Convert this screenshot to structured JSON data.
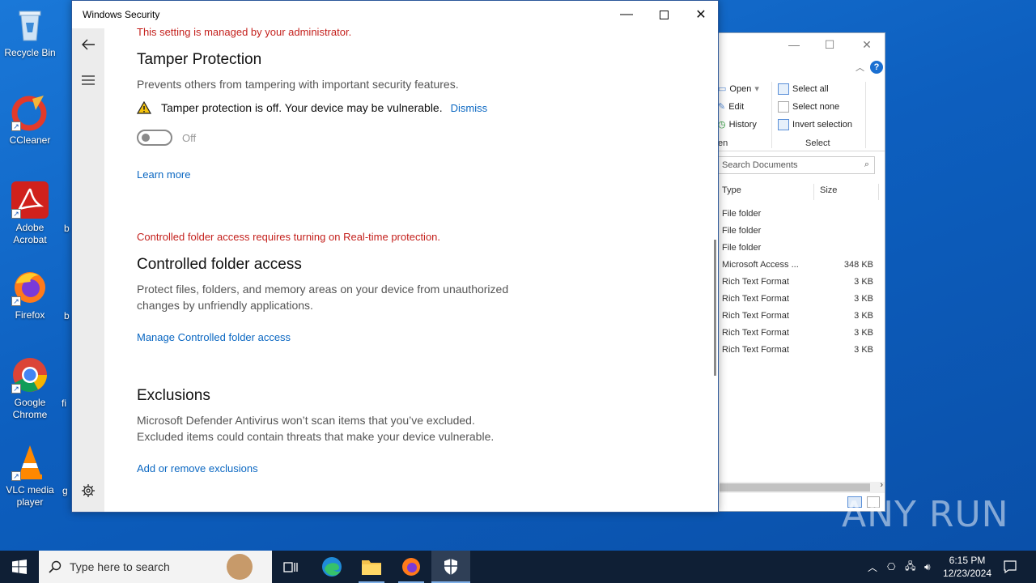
{
  "desktop": {
    "icons": [
      {
        "label": "Recycle Bin"
      },
      {
        "label": "CCleaner"
      },
      {
        "label": "Adobe Acrobat"
      },
      {
        "label": "Firefox"
      },
      {
        "label": "Google Chrome"
      },
      {
        "label": "VLC media player"
      }
    ],
    "partial_labels": [
      "b",
      "b",
      "fi",
      "g"
    ]
  },
  "explorer": {
    "ribbon": {
      "open": "Open",
      "edit": "Edit",
      "history": "History",
      "open_group": "en",
      "select_all": "Select all",
      "select_none": "Select none",
      "invert_selection": "Invert selection",
      "select_group": "Select"
    },
    "search_placeholder": "Search Documents",
    "columns": {
      "type": "Type",
      "size": "Size"
    },
    "rows": [
      {
        "type": "File folder",
        "size": ""
      },
      {
        "type": "File folder",
        "size": ""
      },
      {
        "type": "File folder",
        "size": ""
      },
      {
        "type": "Microsoft Access ...",
        "size": "348 KB"
      },
      {
        "type": "Rich Text Format",
        "size": "3 KB"
      },
      {
        "type": "Rich Text Format",
        "size": "3 KB"
      },
      {
        "type": "Rich Text Format",
        "size": "3 KB"
      },
      {
        "type": "Rich Text Format",
        "size": "3 KB"
      },
      {
        "type": "Rich Text Format",
        "size": "3 KB"
      }
    ]
  },
  "security": {
    "window_title": "Windows Security",
    "admin_notice": "This setting is managed by your administrator.",
    "tamper": {
      "heading": "Tamper Protection",
      "description": "Prevents others from tampering with important security features.",
      "warning": "Tamper protection is off. Your device may be vulnerable.",
      "dismiss": "Dismiss",
      "toggle_state": "Off",
      "learn_more": "Learn more"
    },
    "cfa": {
      "notice": "Controlled folder access requires turning on Real-time protection.",
      "heading": "Controlled folder access",
      "description_line1": "Protect files, folders, and memory areas on your device from unauthorized",
      "description_line2": "changes by unfriendly applications.",
      "manage_link": "Manage Controlled folder access"
    },
    "exclusions": {
      "heading": "Exclusions",
      "description_line1": "Microsoft Defender Antivirus won’t scan items that you’ve excluded.",
      "description_line2": "Excluded items could contain threats that make your device vulnerable.",
      "link": "Add or remove exclusions"
    }
  },
  "watermark": "ANY RUN",
  "taskbar": {
    "search_placeholder": "Type here to search",
    "time": "6:15 PM",
    "date": "12/23/2024"
  }
}
